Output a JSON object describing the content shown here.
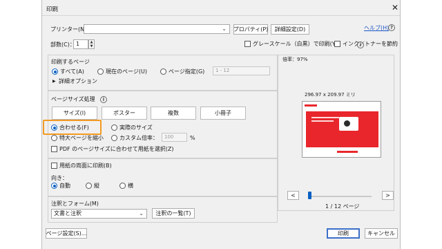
{
  "dialog": {
    "title": "印刷",
    "close_glyph": "✕",
    "help_link": "ヘルプ(H)",
    "help_icon": "question-icon"
  },
  "printer": {
    "label": "プリンター(N)：",
    "value": "",
    "properties_button": "プロパティ(P)",
    "advanced_button": "詳細設定(D)"
  },
  "copies": {
    "label": "部数(C)：",
    "value": "1",
    "grayscale_label": "グレースケール（白黒）で印刷(Y)",
    "grayscale_checked": false,
    "save_ink_label": "インク／トナーを節約",
    "save_ink_checked": false
  },
  "pages_to_print": {
    "heading": "印刷するページ",
    "all_label": "すべて(A)",
    "current_label": "現在のページ(U)",
    "range_label": "ページ指定(G)",
    "range_placeholder": "1 - 12",
    "selected": "all",
    "more_options": "詳細オプション"
  },
  "sizing": {
    "heading": "ページサイズ処理",
    "tabs": [
      "サイズ(I)",
      "ポスター",
      "複数",
      "小冊子"
    ],
    "fit_label": "合わせる(F)",
    "actual_label": "実際のサイズ",
    "shrink_label": "特大ページを縮小",
    "custom_label": "カスタム倍率：",
    "custom_value": "100",
    "custom_unit": "%",
    "paper_source_label": "PDF のページサイズに合わせて用紙を選択(Z)",
    "selected": "fit"
  },
  "duplex": {
    "label": "用紙の両面に印刷(B)",
    "checked": false,
    "orientation_heading": "向き：",
    "auto_label": "自動",
    "portrait_label": "縦",
    "landscape_label": "横",
    "selected": "auto"
  },
  "comments": {
    "heading": "注釈とフォーム(M)",
    "value": "文書と注釈",
    "summary_button": "注釈の一覧(T)"
  },
  "preview": {
    "scale_label": "倍率：97%",
    "paper_size": "296.97 x 209.97 ミリ",
    "prev_button": "<",
    "next_button": ">",
    "page_indicator": "1 / 12 ページ",
    "slider_fraction": 0.0
  },
  "footer": {
    "page_setup_button": "ページ設定(S)...",
    "print_button": "印刷",
    "cancel_button": "キャンセル"
  },
  "colors": {
    "accent": "#0a60c2",
    "highlight": "#f39a21",
    "slide_red": "#e8262b"
  }
}
